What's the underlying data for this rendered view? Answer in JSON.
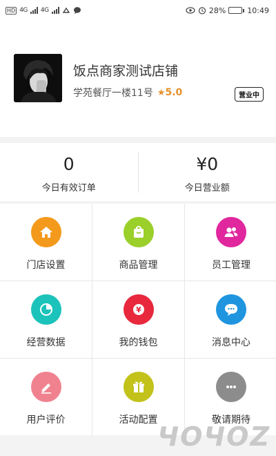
{
  "status_bar": {
    "hd": "HD",
    "net1": "4G",
    "net2": "4G",
    "battery": "28%",
    "battery_level": 0.28,
    "time": "10:49"
  },
  "store": {
    "name": "饭点商家测试店铺",
    "address": "学苑餐厅一楼11号",
    "rating": "5.0",
    "status": "营业中"
  },
  "stats": [
    {
      "value": "0",
      "label": "今日有效订单"
    },
    {
      "value": "¥0",
      "label": "今日营业额"
    }
  ],
  "menu": [
    {
      "label": "门店设置",
      "icon": "home-icon",
      "color": "#f39a1c"
    },
    {
      "label": "商品管理",
      "icon": "shopping-bag-icon",
      "color": "#9bcf2a"
    },
    {
      "label": "员工管理",
      "icon": "staff-icon",
      "color": "#e0279e"
    },
    {
      "label": "经营数据",
      "icon": "pie-chart-icon",
      "color": "#1cc3ba"
    },
    {
      "label": "我的钱包",
      "icon": "wallet-icon",
      "color": "#e8283d"
    },
    {
      "label": "消息中心",
      "icon": "message-icon",
      "color": "#1f95e0"
    },
    {
      "label": "用户评价",
      "icon": "review-pen-icon",
      "color": "#f08290"
    },
    {
      "label": "活动配置",
      "icon": "gift-icon",
      "color": "#c2c21a"
    },
    {
      "label": "敬请期待",
      "icon": "more-icon",
      "color": "#8c8c8c"
    }
  ],
  "watermark": "ЧОЧОZ"
}
